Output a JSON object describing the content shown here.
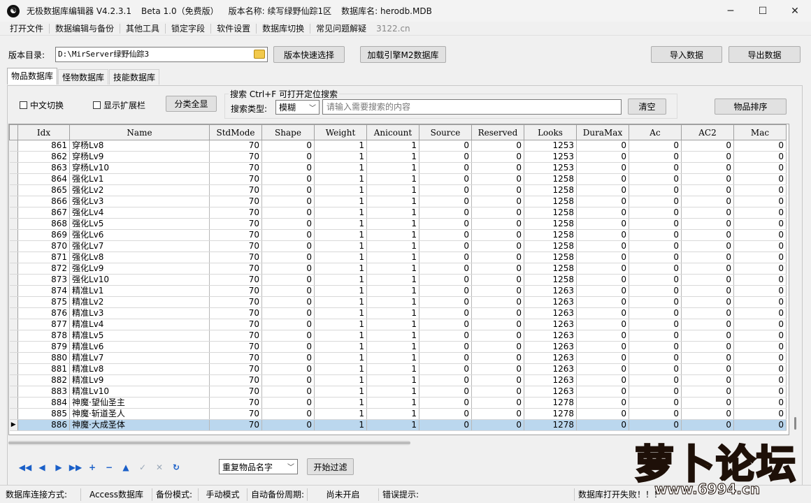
{
  "titlebar": {
    "app_name": "无极数据库编辑器 V4.2.3.1",
    "beta": "Beta 1.0（免费版）",
    "version_name": "版本名称: 续写绿野仙踪1区",
    "db_name": "数据库名: herodb.MDB",
    "minimize": "─",
    "maximize": "☐",
    "close": "✕"
  },
  "menu": {
    "items": [
      "打开文件",
      "数据编辑与备份",
      "其他工具",
      "锁定字段",
      "软件设置",
      "数据库切换",
      "常见问题解疑"
    ],
    "url": "3122.cn"
  },
  "toolbar": {
    "dir_label": "版本目录:",
    "dir_value": "D:\\MirServer绿野仙踪3",
    "quick_select": "版本快速选择",
    "load_engine": "加载引擎M2数据库",
    "import": "导入数据",
    "export": "导出数据"
  },
  "tabs": [
    "物品数据库",
    "怪物数据库",
    "技能数据库"
  ],
  "filters": {
    "chinese_toggle": "中文切换",
    "show_ext": "显示扩展栏",
    "expand_all": "分类全显",
    "search_legend": "搜索  Ctrl+F 可打开定位搜索",
    "search_type_label": "搜索类型:",
    "search_type_value": "模糊",
    "search_placeholder": "请输入需要搜索的内容",
    "clear": "清空",
    "sort": "物品排序"
  },
  "grid": {
    "columns": [
      "Idx",
      "Name",
      "StdMode",
      "Shape",
      "Weight",
      "Anicount",
      "Source",
      "Reserved",
      "Looks",
      "DuraMax",
      "Ac",
      "AC2",
      "Mac"
    ],
    "rows": [
      [
        "861",
        "穿杨Lv8",
        "70",
        "0",
        "1",
        "1",
        "0",
        "0",
        "1253",
        "0",
        "0",
        "0",
        "0"
      ],
      [
        "862",
        "穿杨Lv9",
        "70",
        "0",
        "1",
        "1",
        "0",
        "0",
        "1253",
        "0",
        "0",
        "0",
        "0"
      ],
      [
        "863",
        "穿杨Lv10",
        "70",
        "0",
        "1",
        "1",
        "0",
        "0",
        "1253",
        "0",
        "0",
        "0",
        "0"
      ],
      [
        "864",
        "强化Lv1",
        "70",
        "0",
        "1",
        "1",
        "0",
        "0",
        "1258",
        "0",
        "0",
        "0",
        "0"
      ],
      [
        "865",
        "强化Lv2",
        "70",
        "0",
        "1",
        "1",
        "0",
        "0",
        "1258",
        "0",
        "0",
        "0",
        "0"
      ],
      [
        "866",
        "强化Lv3",
        "70",
        "0",
        "1",
        "1",
        "0",
        "0",
        "1258",
        "0",
        "0",
        "0",
        "0"
      ],
      [
        "867",
        "强化Lv4",
        "70",
        "0",
        "1",
        "1",
        "0",
        "0",
        "1258",
        "0",
        "0",
        "0",
        "0"
      ],
      [
        "868",
        "强化Lv5",
        "70",
        "0",
        "1",
        "1",
        "0",
        "0",
        "1258",
        "0",
        "0",
        "0",
        "0"
      ],
      [
        "869",
        "强化Lv6",
        "70",
        "0",
        "1",
        "1",
        "0",
        "0",
        "1258",
        "0",
        "0",
        "0",
        "0"
      ],
      [
        "870",
        "强化Lv7",
        "70",
        "0",
        "1",
        "1",
        "0",
        "0",
        "1258",
        "0",
        "0",
        "0",
        "0"
      ],
      [
        "871",
        "强化Lv8",
        "70",
        "0",
        "1",
        "1",
        "0",
        "0",
        "1258",
        "0",
        "0",
        "0",
        "0"
      ],
      [
        "872",
        "强化Lv9",
        "70",
        "0",
        "1",
        "1",
        "0",
        "0",
        "1258",
        "0",
        "0",
        "0",
        "0"
      ],
      [
        "873",
        "强化Lv10",
        "70",
        "0",
        "1",
        "1",
        "0",
        "0",
        "1258",
        "0",
        "0",
        "0",
        "0"
      ],
      [
        "874",
        "精准Lv1",
        "70",
        "0",
        "1",
        "1",
        "0",
        "0",
        "1263",
        "0",
        "0",
        "0",
        "0"
      ],
      [
        "875",
        "精准Lv2",
        "70",
        "0",
        "1",
        "1",
        "0",
        "0",
        "1263",
        "0",
        "0",
        "0",
        "0"
      ],
      [
        "876",
        "精准Lv3",
        "70",
        "0",
        "1",
        "1",
        "0",
        "0",
        "1263",
        "0",
        "0",
        "0",
        "0"
      ],
      [
        "877",
        "精准Lv4",
        "70",
        "0",
        "1",
        "1",
        "0",
        "0",
        "1263",
        "0",
        "0",
        "0",
        "0"
      ],
      [
        "878",
        "精准Lv5",
        "70",
        "0",
        "1",
        "1",
        "0",
        "0",
        "1263",
        "0",
        "0",
        "0",
        "0"
      ],
      [
        "879",
        "精准Lv6",
        "70",
        "0",
        "1",
        "1",
        "0",
        "0",
        "1263",
        "0",
        "0",
        "0",
        "0"
      ],
      [
        "880",
        "精准Lv7",
        "70",
        "0",
        "1",
        "1",
        "0",
        "0",
        "1263",
        "0",
        "0",
        "0",
        "0"
      ],
      [
        "881",
        "精准Lv8",
        "70",
        "0",
        "1",
        "1",
        "0",
        "0",
        "1263",
        "0",
        "0",
        "0",
        "0"
      ],
      [
        "882",
        "精准Lv9",
        "70",
        "0",
        "1",
        "1",
        "0",
        "0",
        "1263",
        "0",
        "0",
        "0",
        "0"
      ],
      [
        "883",
        "精准Lv10",
        "70",
        "0",
        "1",
        "1",
        "0",
        "0",
        "1263",
        "0",
        "0",
        "0",
        "0"
      ],
      [
        "884",
        "神魔·望仙圣主",
        "70",
        "0",
        "1",
        "1",
        "0",
        "0",
        "1278",
        "0",
        "0",
        "0",
        "0"
      ],
      [
        "885",
        "神魔·斩道圣人",
        "70",
        "0",
        "1",
        "1",
        "0",
        "0",
        "1278",
        "0",
        "0",
        "0",
        "0"
      ],
      [
        "886",
        "神魔·大成圣体",
        "70",
        "0",
        "1",
        "1",
        "0",
        "0",
        "1278",
        "0",
        "0",
        "0",
        "0"
      ]
    ],
    "selected_index": 25,
    "selected_color": "#bbd7ee"
  },
  "bottom": {
    "nav_icons": [
      "first-icon",
      "prior-icon",
      "next-icon",
      "last-icon",
      "insert-icon",
      "delete-icon",
      "edit-icon",
      "post-icon",
      "cancel-icon",
      "refresh-icon"
    ],
    "nav_glyphs": [
      "◀◀",
      "◀",
      "▶",
      "▶▶",
      "+",
      "−",
      "▲",
      "✓",
      "✕",
      "↻"
    ],
    "filter_select": "重复物品名字",
    "start_filter": "开始过滤"
  },
  "status": {
    "conn_label": "数据库连接方式:",
    "conn_value": "Access数据库",
    "backup_label": "备份模式:",
    "backup_value": "手动模式",
    "auto_label": "自动备份周期:",
    "auto_value": "尚未开启",
    "error_label": "错误提示:",
    "error_value": "数据库打开失败！！！"
  },
  "watermark": {
    "text": "萝卜论坛",
    "url": "www.6994.cn"
  }
}
